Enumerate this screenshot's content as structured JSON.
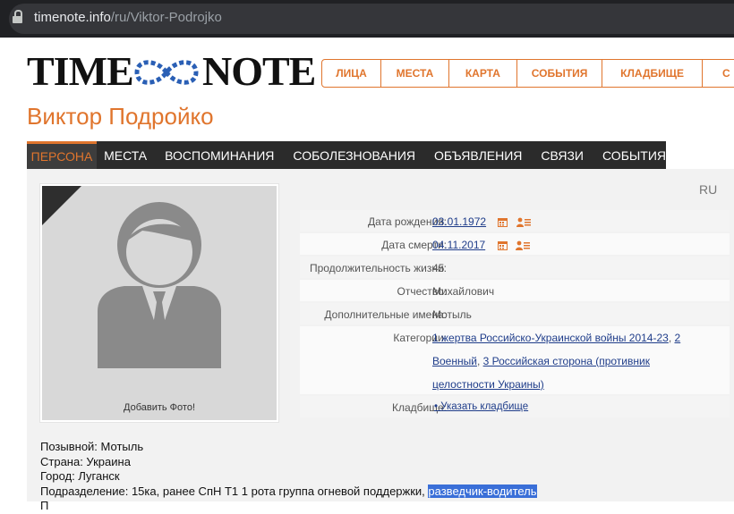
{
  "browser": {
    "url_domain": "timenote.info",
    "url_path": "/ru/Viktor-Podrojko"
  },
  "logo": {
    "left_word": "TIME",
    "right_word": "NOTE"
  },
  "topnav": [
    {
      "label": "ЛИЦА"
    },
    {
      "label": "МЕСТА"
    },
    {
      "label": "КАРТА"
    },
    {
      "label": "СОБЫТИЯ"
    },
    {
      "label": "КЛАДБИЩЕ"
    },
    {
      "label": "С"
    }
  ],
  "person_name": "Виктор Подройко",
  "tabs": [
    {
      "label": "ПЕРСОНА"
    },
    {
      "label": "МЕСТА"
    },
    {
      "label": "ВОСПОМИНАНИЯ"
    },
    {
      "label": "СОБОЛЕЗНОВАНИЯ"
    },
    {
      "label": "ОБЪЯВЛЕНИЯ"
    },
    {
      "label": "СВЯЗИ"
    },
    {
      "label": "СОБЫТИЯ"
    }
  ],
  "lang": "RU",
  "photo": {
    "add_label": "Добавить Фото!"
  },
  "info": {
    "birth_label": "Дата рождения:",
    "birth_value": "03.01.1972",
    "death_label": "Дата смерти:",
    "death_value": "04.11.2017",
    "duration_label": "Продолжительность жизни:",
    "duration_value": "45",
    "patronymic_label": "Отчество:",
    "patronymic_value": "Михайлович",
    "extra_names_label": "Дополнительные имена:",
    "extra_names_value": "Мотыль",
    "categories_label": "Категории:",
    "cat1": "1 жертва Российско-Украинской войны 2014-23",
    "cat2": "2 Военный",
    "cat3": "3 Российская сторона (противник целостности Украины)",
    "cemetery_label": "Кладбище:",
    "cemetery_value": "• Указать кладбище"
  },
  "bio": {
    "line1": "Позывной: Мотыль",
    "line2": "Страна: Украина",
    "line3": "Город: Луганск",
    "line4_prefix": "Подразделение: 15ка, ранее СпН Т1 1 рота группа огневой поддержки, ",
    "line4_highlight": "разведчик-водитель",
    "line5": "П"
  },
  "colors": {
    "accent": "#e0752d",
    "tabbar": "#2b2b2b",
    "link": "#1f3d8a",
    "selection": "#3a6fd8"
  }
}
